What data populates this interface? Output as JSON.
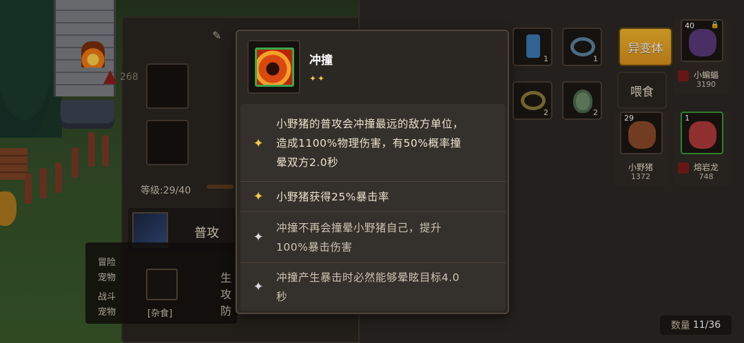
{
  "background": {
    "level_text": "等级:29/40",
    "attack_label": "普攻",
    "food_tag": "[杂食]",
    "count_label": "数量",
    "count_value": "11/36",
    "side_labels": [
      "冒险",
      "宠物",
      "战斗",
      "宠物"
    ],
    "stat_labels": [
      "生",
      "攻",
      "防"
    ],
    "partial_number": "268"
  },
  "right_panel": {
    "mutant_button": "异变体",
    "feed_button": "喂食",
    "inventory": [
      {
        "icon": "totem-icon",
        "count": "1"
      },
      {
        "icon": "blue-ring-icon",
        "count": "1"
      },
      {
        "icon": "gold-ring-icon",
        "count": "2"
      },
      {
        "icon": "green-gem-icon",
        "count": "2"
      }
    ],
    "pets": [
      {
        "level": "40",
        "name": "小蝙蝠",
        "value": "3190",
        "locked": true
      },
      {
        "level": "29",
        "name": "小野猪",
        "value": "1372",
        "locked": false
      },
      {
        "level": "1",
        "name": "熔岩龙",
        "value": "748",
        "locked": false
      }
    ]
  },
  "tooltip": {
    "skill_name": "冲撞",
    "skill_stars": "✦✦",
    "effects": [
      {
        "star": "gold",
        "lines": [
          "小野猪的普攻会冲撞最远的敌方单位，",
          "造成1100%物理伤害，有50%概率撞",
          "晕双方2.0秒"
        ]
      },
      {
        "star": "gold",
        "lines": [
          "小野猪获得25%暴击率"
        ]
      },
      {
        "star": "silver",
        "lines": [
          "冲撞不再会撞晕小野猪自己，提升",
          "100%暴击伤害"
        ]
      },
      {
        "star": "silver",
        "lines": [
          "冲撞产生暴击时必然能够晕眩目标4.0",
          "秒"
        ]
      }
    ]
  },
  "colors": {
    "accent_gold": "#f2c94c",
    "mutant_button": "#f2b62c",
    "icon_border_green": "#3ba84a"
  }
}
